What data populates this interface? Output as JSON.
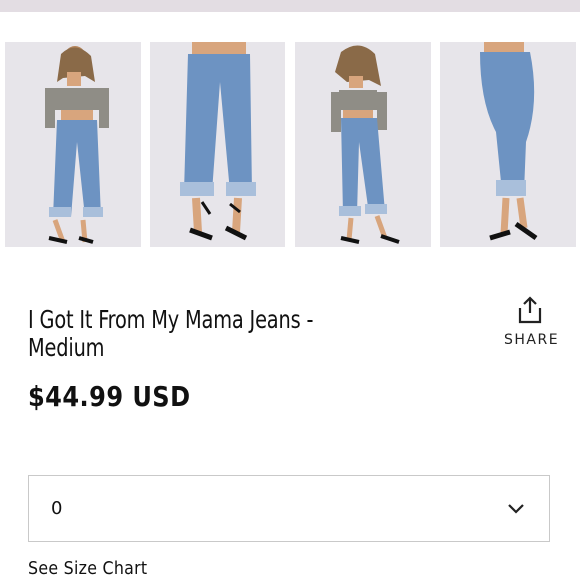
{
  "product": {
    "title": "I Got It From My Mama Jeans - Medium",
    "price": "$44.99 USD"
  },
  "share": {
    "label": "SHARE",
    "icon": "share-icon"
  },
  "size_select": {
    "value": "0",
    "icon": "chevron-down-icon"
  },
  "size_chart_link": "See Size Chart",
  "gallery": {
    "thumbnails": [
      {
        "name": "front-view"
      },
      {
        "name": "legs-front-view"
      },
      {
        "name": "side-view"
      },
      {
        "name": "back-side-view"
      }
    ]
  },
  "colors": {
    "topbar": "#e3dde3",
    "thumb_bg": "#e7e5ea",
    "denim": "#6d93c2",
    "border": "#c9c9c9"
  }
}
